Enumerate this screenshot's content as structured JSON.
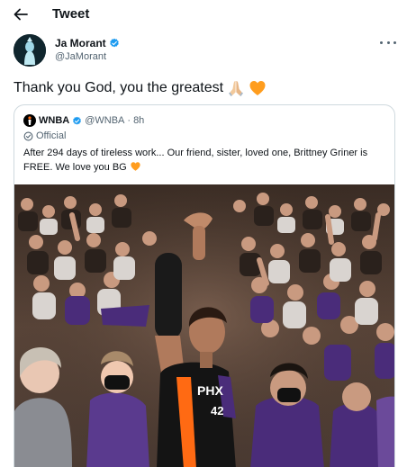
{
  "header": {
    "back_icon": "arrow-left-icon",
    "title": "Tweet"
  },
  "tweet": {
    "author_name": "Ja Morant",
    "handle": "@JaMorant",
    "verified_icon": "verified-badge-icon",
    "more_icon": "more-horizontal-icon",
    "text": "Thank you God, you the greatest",
    "emojis": [
      "folded-hands-icon",
      "orange-heart-icon"
    ]
  },
  "quoted_tweet": {
    "author_name": "WNBA",
    "handle": "@WNBA",
    "separator": "·",
    "time": "8h",
    "label": "Official",
    "text": "After 294 days of tireless work... Our friend, sister, loved one, Brittney Griner is FREE. We love you BG",
    "emoji": "orange-heart-icon",
    "jersey_text": "PHX",
    "jersey_number": "42"
  },
  "colors": {
    "verified": "#1d9bf0",
    "text_primary": "#0f1419",
    "text_secondary": "#536471",
    "border": "#cfd9de",
    "orange_heart": "#ff9d1e",
    "jersey_purple": "#4a2c7a"
  }
}
